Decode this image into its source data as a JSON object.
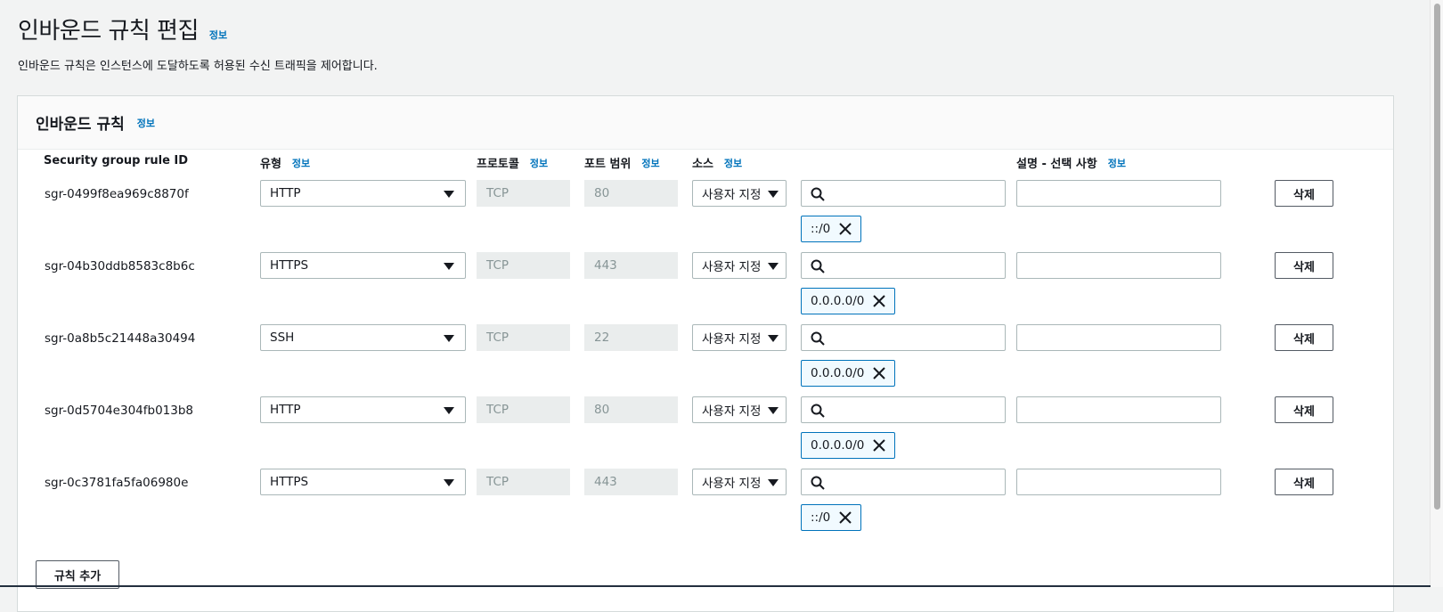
{
  "page": {
    "title": "인바운드 규칙 편집",
    "info": "정보",
    "description": "인바운드 규칙은 인스턴스에 도달하도록 허용된 수신 트래픽을 제어합니다."
  },
  "panel": {
    "title": "인바운드 규칙",
    "info": "정보",
    "columns": {
      "rule_id": "Security group rule ID",
      "type": "유형",
      "protocol": "프로토콜",
      "port_range": "포트 범위",
      "source": "소스",
      "description": "설명 - 선택 사항",
      "info": "정보"
    },
    "delete_label": "삭제",
    "add_rule_label": "규칙 추가"
  },
  "rules": [
    {
      "id": "sgr-0499f8ea969c8870f",
      "type": "HTTP",
      "protocol": "TCP",
      "port": "80",
      "source_type": "사용자 지정",
      "cidr": "::/0",
      "description": ""
    },
    {
      "id": "sgr-04b30ddb8583c8b6c",
      "type": "HTTPS",
      "protocol": "TCP",
      "port": "443",
      "source_type": "사용자 지정",
      "cidr": "0.0.0.0/0",
      "description": ""
    },
    {
      "id": "sgr-0a8b5c21448a30494",
      "type": "SSH",
      "protocol": "TCP",
      "port": "22",
      "source_type": "사용자 지정",
      "cidr": "0.0.0.0/0",
      "description": ""
    },
    {
      "id": "sgr-0d5704e304fb013b8",
      "type": "HTTP",
      "protocol": "TCP",
      "port": "80",
      "source_type": "사용자 지정",
      "cidr": "0.0.0.0/0",
      "description": ""
    },
    {
      "id": "sgr-0c3781fa5fa06980e",
      "type": "HTTPS",
      "protocol": "TCP",
      "port": "443",
      "source_type": "사용자 지정",
      "cidr": "::/0",
      "description": ""
    }
  ],
  "colors": {
    "link": "#0073bb",
    "token_border": "#0073bb",
    "readonly_bg": "#eaeded"
  }
}
